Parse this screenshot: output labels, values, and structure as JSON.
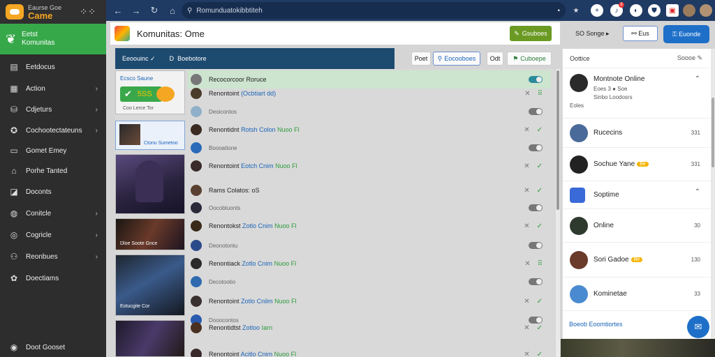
{
  "sidebar": {
    "brand_top": "Eaurse Goe",
    "brand_name": "Came",
    "feature_label_1": "Eetst",
    "feature_label_2": "Komunitas",
    "items": [
      {
        "label": "Eetdocus",
        "icon": "image-icon",
        "chevron": false
      },
      {
        "label": "Action",
        "icon": "list-icon",
        "chevron": true
      },
      {
        "label": "Cdjeturs",
        "icon": "bag-icon",
        "chevron": true
      },
      {
        "label": "Cochootectateuns",
        "icon": "controller-icon",
        "chevron": true
      },
      {
        "label": "Gomet Emey",
        "icon": "chat-icon",
        "chevron": false
      },
      {
        "label": "Porhe Tanted",
        "icon": "home-icon",
        "chevron": false
      },
      {
        "label": "Doconts",
        "icon": "tag-icon",
        "chevron": false
      },
      {
        "label": "Conitcle",
        "icon": "circle-icon",
        "chevron": true
      },
      {
        "label": "Cogricle",
        "icon": "globe-icon",
        "chevron": true
      },
      {
        "label": "Reonbues",
        "icon": "group-icon",
        "chevron": true
      },
      {
        "label": "Doectiams",
        "icon": "game-icon",
        "chevron": false
      }
    ],
    "footer_label": "Doot Gooset"
  },
  "topbar": {
    "search_placeholder": "Romunduatokibbtiteh",
    "notification_count": "8"
  },
  "titlebar": {
    "title": "Komunitas: Ome",
    "join_label": "Gsuboes",
    "count_label": "SO Songe",
    "tool_button_label": "Eus",
    "primary_button_label": "Euonde"
  },
  "tabs": {
    "active": "Eeoouinc",
    "second": "Boebotore",
    "filter_buttons": [
      "Poet",
      "Eocooboes",
      "Odt",
      "Cuboepe"
    ]
  },
  "feed": {
    "card1_title": "Ecsco Saune",
    "card1_badge": "5SS",
    "card1_foot": "Coo Lerce Tor",
    "card2_caption": "Ctonu Sumetoo",
    "card4_caption": "Dloe Soote Gnce",
    "card5_caption": "Eotucgite Cor",
    "rows": [
      {
        "name": "Recocorcoor Roruce",
        "accent": "",
        "green": "",
        "style": "highlight"
      },
      {
        "name": "Renontoint",
        "accent": "(Ocbtiart dd)",
        "green": "",
        "style": "main"
      },
      {
        "name": "Deoicontos",
        "accent": "",
        "green": "",
        "style": "sub"
      },
      {
        "name": "Renontidnt",
        "accent": "Rotsh Colon",
        "green": "Nuoo Fl",
        "style": "main"
      },
      {
        "name": "Boooatione",
        "accent": "",
        "green": "",
        "style": "sub"
      },
      {
        "name": "Renontoint",
        "accent": "Eotch Cnim",
        "green": "Nuoo Fl",
        "style": "main"
      },
      {
        "name": "Rams Colatos: oS",
        "accent": "",
        "green": "",
        "style": "main"
      },
      {
        "name": "Oocobtuonts",
        "accent": "",
        "green": "",
        "style": "sub"
      },
      {
        "name": "Renontokst",
        "accent": "Zotlo Cnim",
        "green": "Nuoo Fl",
        "style": "main"
      },
      {
        "name": "Deonotontu",
        "accent": "",
        "green": "",
        "style": "sub"
      },
      {
        "name": "Renontiack",
        "accent": "Zotlo Cnim",
        "green": "Nuoo Fl",
        "style": "main"
      },
      {
        "name": "Decotootio",
        "accent": "",
        "green": "",
        "style": "sub"
      },
      {
        "name": "Renontoint",
        "accent": "Zotlo Cnilm",
        "green": "Nuoo Fl",
        "style": "main"
      },
      {
        "name": "Dooocontos",
        "accent": "",
        "green": "",
        "style": "sub"
      },
      {
        "name": "Renontidtst",
        "accent": "Zotloo",
        "green": "Iarn",
        "style": "main"
      },
      {
        "name": "Renontoint",
        "accent": "Acitlo Cnim",
        "green": "Nuoo Fl",
        "style": "main"
      }
    ]
  },
  "right_panel": {
    "header": "Oottice",
    "header_more": "Soooe",
    "items": [
      {
        "name": "Montnote Online",
        "sub": "Eoes 3 ● Soe",
        "sub2": "Sinbo Loodosrs",
        "sub3": "Eoles",
        "meta": "",
        "chevron": "up"
      },
      {
        "name": "Rucecins",
        "meta": "331"
      },
      {
        "name": "Sochue Yane",
        "pill": "Be",
        "meta": "331"
      },
      {
        "name": "Soptime",
        "meta": "",
        "chevron": "up"
      },
      {
        "name": "Online",
        "meta": "30"
      },
      {
        "name": "Sori Gadoe",
        "pill": "Be",
        "meta": "130"
      },
      {
        "name": "Kominetae",
        "meta": "33"
      }
    ],
    "footer_link": "Boeob Eoomtiortes"
  }
}
